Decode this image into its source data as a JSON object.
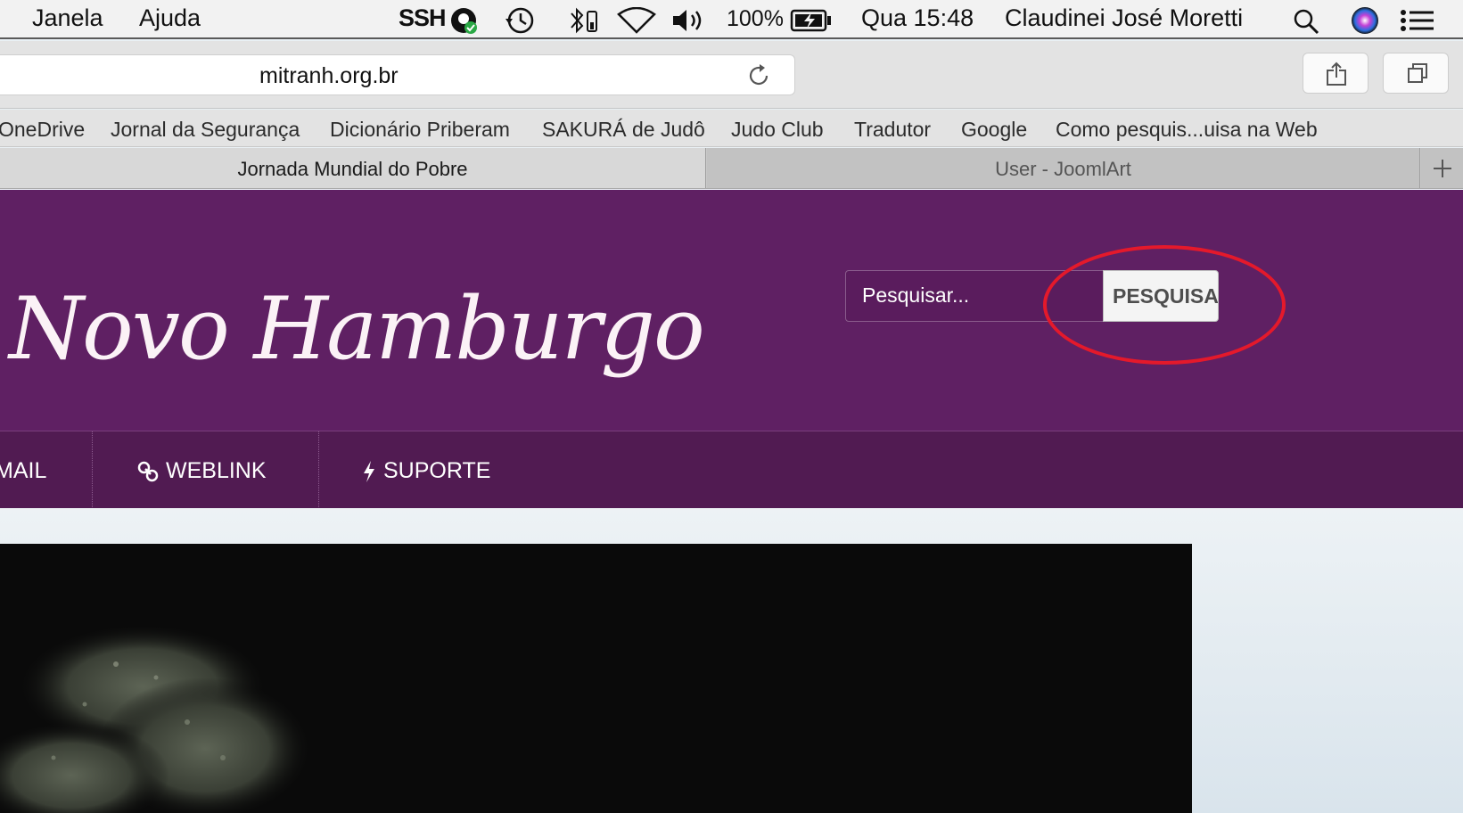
{
  "menubar": {
    "items": [
      "Janela",
      "Ajuda"
    ],
    "ssh": "SSH",
    "battery": "100%",
    "clock": "Qua 15:48",
    "user": "Claudinei José Moretti",
    "icons": [
      "stamp-icon",
      "time-machine-icon",
      "bluetooth-icon",
      "wifi-icon",
      "volume-icon",
      "battery-icon",
      "spotlight-icon",
      "siri-icon",
      "notification-center-icon"
    ]
  },
  "toolbar": {
    "url": "mitranh.org.br",
    "icons": [
      "reload-icon",
      "share-icon",
      "tabs-overview-icon"
    ]
  },
  "bookmarks": [
    "OneDrive",
    "Jornal da Segurança",
    "Dicionário Priberam",
    "SAKURÁ de Judô",
    "Judo Club",
    "Tradutor",
    "Google",
    "Como pesquis...uisa na Web"
  ],
  "tabs": {
    "active": "Jornada Mundial do Pobre",
    "inactive": "User - JoomlArt",
    "new_tab_icon": "plus-icon"
  },
  "site": {
    "logo": "Novo Hamburgo",
    "search_placeholder": "Pesquisar...",
    "search_button": "PESQUISA",
    "highlight_color": "#e4192b",
    "header_color": "#5f2063",
    "nav": {
      "mail": "MAIL",
      "weblink": "WEBLINK",
      "suporte": "SUPORTE"
    }
  }
}
